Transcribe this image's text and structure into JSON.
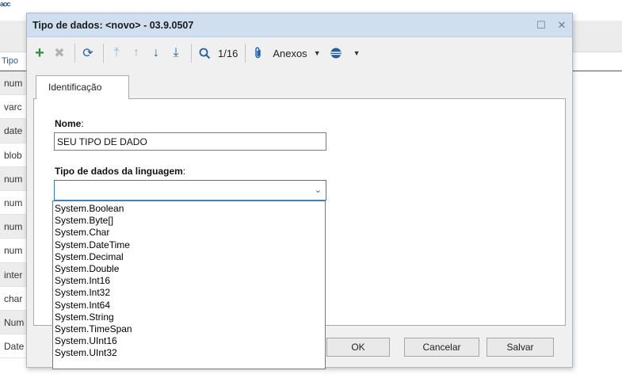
{
  "background": {
    "logo": "aoc",
    "header_label": "Tipo",
    "rows": [
      "num",
      "varc",
      "date",
      "blob",
      "num",
      "num",
      "num",
      "num",
      "inter",
      "char",
      "Num",
      "Date"
    ]
  },
  "dialog": {
    "title": "Tipo de dados: <novo> - 03.9.0507",
    "maximize_glyph": "☐",
    "close_glyph": "✕",
    "toolbar": {
      "add_glyph": "+",
      "delete_glyph": "✖",
      "refresh_glyph": "⟳",
      "first_glyph": "⤒",
      "prev_glyph": "↑",
      "next_glyph": "↓",
      "last_glyph": "⤓",
      "search_glyph": "🔍",
      "page_indicator": "1/16",
      "attach_glyph": "📎",
      "anexos_label": "Anexos",
      "caret_glyph": "▼",
      "web_glyph": "⊜"
    },
    "tab_label": "Identificação",
    "nome_label": "Nome",
    "colon": ":",
    "nome_value": "SEU TIPO DE DADO",
    "tipo_label": "Tipo de dados da linguagem",
    "select_value": "",
    "select_arrow_glyph": "⌄",
    "options": [
      "System.Boolean",
      "System.Byte[]",
      "System.Char",
      "System.DateTime",
      "System.Decimal",
      "System.Double",
      "System.Int16",
      "System.Int32",
      "System.Int64",
      "System.String",
      "System.TimeSpan",
      "System.UInt16",
      "System.UInt32"
    ],
    "buttons": {
      "ok": "OK",
      "cancel": "Cancelar",
      "save": "Salvar"
    }
  }
}
